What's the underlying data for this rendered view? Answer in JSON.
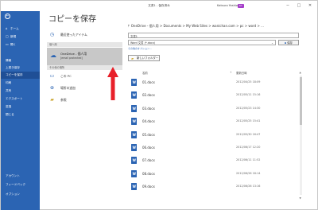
{
  "window": {
    "title": "文書1 - 保存済み",
    "user": "Katsuro Yoshio",
    "user_badge": "KY",
    "controls": [
      "−",
      "□",
      "✕"
    ]
  },
  "backstage": {
    "back_icon": "←",
    "items": [
      {
        "label": "ホーム",
        "icon": "⌂"
      },
      {
        "label": "新規",
        "icon": "▢"
      },
      {
        "label": "開く",
        "icon": "▭"
      },
      {
        "label": "情報",
        "icon": ""
      },
      {
        "label": "上書き保存",
        "icon": ""
      },
      {
        "label": "コピーを保存",
        "icon": "",
        "active": true
      },
      {
        "label": "印刷",
        "icon": ""
      },
      {
        "label": "共有",
        "icon": ""
      },
      {
        "label": "エクスポート",
        "icon": ""
      },
      {
        "label": "変換",
        "icon": ""
      },
      {
        "label": "閉じる",
        "icon": ""
      }
    ],
    "bottom_items": [
      {
        "label": "アカウント"
      },
      {
        "label": "フィードバック"
      },
      {
        "label": "オプション"
      }
    ]
  },
  "page_title": "コピーを保存",
  "locations": {
    "recent": "最近使ったアイテム",
    "personal_header": "個人用",
    "onedrive_title": "OneDrive - 個人用",
    "onedrive_email": "[email protected]",
    "other_header": "その他の場所",
    "this_pc": "この PC",
    "add_place": "場所の追加",
    "browse": "参照"
  },
  "save_panel": {
    "path": "OneDrive - 個人用 > Documents > My Web Sites > wanichan.com > pc > word > ...",
    "file_name": "文書1",
    "file_type": "Word 文書 (*.docx)",
    "save_label": "保存",
    "more_options": "その他のオプション...",
    "new_folder_label": "新しいフォルダー",
    "col_name": "名前",
    "col_date": "更新日時",
    "files": [
      {
        "name": "01.docx",
        "date": "2012/04/25 18:09"
      },
      {
        "name": "02.docx",
        "date": "2012/05/11 15:16"
      },
      {
        "name": "03.docx",
        "date": "2012/05/23 14:30"
      },
      {
        "name": "04.docx",
        "date": "2012/05/25 15:41"
      },
      {
        "name": "05.docx",
        "date": "2012/05/30 16:47"
      },
      {
        "name": "06.docx",
        "date": "2012/06/17 12:20"
      },
      {
        "name": "07.docx",
        "date": "2012/06/11 11:52"
      },
      {
        "name": "08.docx",
        "date": "2012/06/26 18:14"
      },
      {
        "name": "09.docx",
        "date": "2012/06/26 13:16"
      }
    ]
  },
  "colors": {
    "backstage": "#2b64b3",
    "accent": "#2b64b3",
    "arrow": "#e8202a"
  }
}
